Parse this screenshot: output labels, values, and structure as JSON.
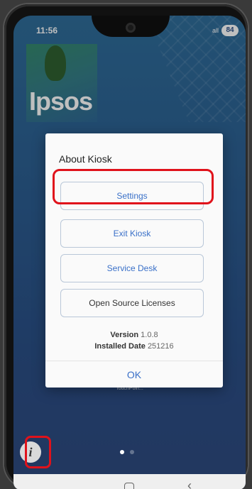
{
  "status_bar": {
    "time": "11:56",
    "signal": "all",
    "battery": "84"
  },
  "background": {
    "logo_text": "Ipsos"
  },
  "dialog": {
    "title": "About Kiosk",
    "buttons": [
      {
        "label": "Settings"
      },
      {
        "label": "Exit Kiosk"
      },
      {
        "label": "Service Desk"
      },
      {
        "label": "Open Source Licenses"
      }
    ],
    "version_label": "Version",
    "version_value": "1.0.8",
    "installed_label": "Installed Date",
    "installed_value": "251216",
    "ok_label": "OK"
  },
  "home": {
    "app_label": "TouchPoin...",
    "info_icon": "i"
  },
  "colors": {
    "accent": "#3a70c8",
    "highlight": "#e0121b"
  },
  "icons": [
    "info-icon",
    "home-icon",
    "back-icon",
    "camera-icon"
  ]
}
